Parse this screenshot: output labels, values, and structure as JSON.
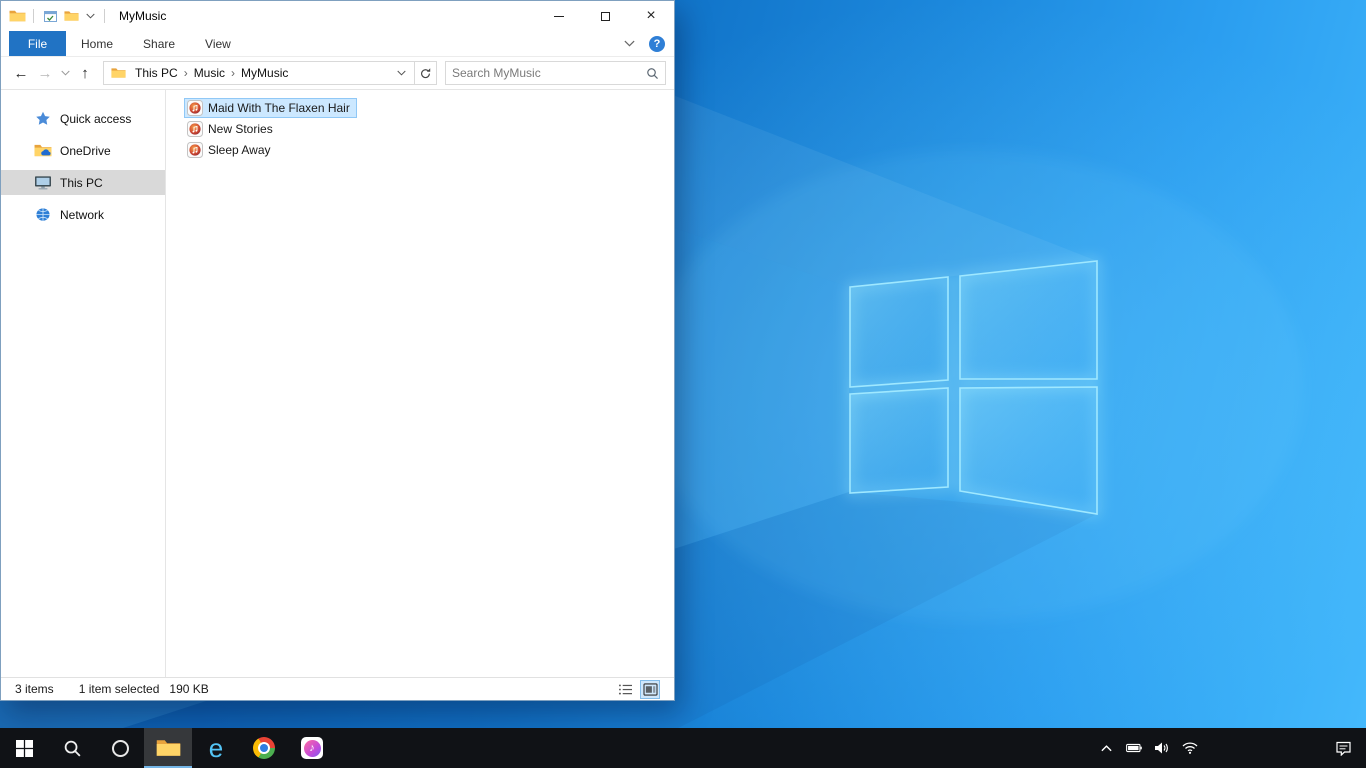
{
  "window": {
    "title": "MyMusic",
    "close_glyph": "×"
  },
  "ribbon": {
    "tabs": [
      {
        "label": "File",
        "active": true
      },
      {
        "label": "Home",
        "active": false
      },
      {
        "label": "Share",
        "active": false
      },
      {
        "label": "View",
        "active": false
      }
    ],
    "help_glyph": "?"
  },
  "navigation": {
    "back_glyph": "←",
    "forward_glyph": "→",
    "up_glyph": "↑",
    "breadcrumb": [
      {
        "label": "This PC"
      },
      {
        "label": "Music"
      },
      {
        "label": "MyMusic"
      }
    ],
    "crumb_separator": "›",
    "search_placeholder": "Search MyMusic"
  },
  "sidebar": {
    "items": [
      {
        "label": "Quick access",
        "icon": "quick-access-star",
        "selected": false
      },
      {
        "label": "OneDrive",
        "icon": "onedrive-folder",
        "selected": false
      },
      {
        "label": "This PC",
        "icon": "this-pc-monitor",
        "selected": true
      },
      {
        "label": "Network",
        "icon": "network-globe",
        "selected": false
      }
    ]
  },
  "files": [
    {
      "name": "Maid With The Flaxen Hair",
      "icon": "audio-file",
      "selected": true
    },
    {
      "name": "New Stories",
      "icon": "audio-file",
      "selected": false
    },
    {
      "name": "Sleep Away",
      "icon": "audio-file",
      "selected": false
    }
  ],
  "status_bar": {
    "item_count": "3 items",
    "selection_summary": "1 item selected",
    "selection_size": "190 KB"
  },
  "taskbar": {
    "ie_glyph": "e",
    "itunes_note_glyph": "♪"
  },
  "colors": {
    "selection_bg": "#cce8ff",
    "selection_border": "#90c8f6",
    "sidebar_selected": "#d9d9d9",
    "file_tab_blue": "#2173c4",
    "help_blue": "#2f7fd6",
    "taskbar_bg": "#101216"
  }
}
